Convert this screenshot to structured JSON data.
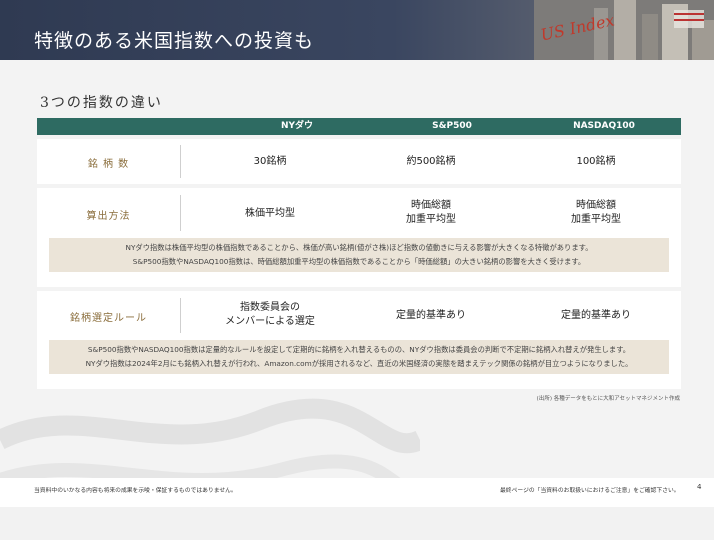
{
  "header": {
    "title": "特徴のある米国指数への投資も",
    "logo_text": "US Index"
  },
  "section": {
    "title": "3つの指数の違い"
  },
  "table": {
    "columns": [
      "NYダウ",
      "S&P500",
      "NASDAQ100"
    ],
    "rows": [
      {
        "label": "銘 柄 数",
        "cells": [
          [
            "30銘柄"
          ],
          [
            "約500銘柄"
          ],
          [
            "100銘柄"
          ]
        ]
      },
      {
        "label": "算出方法",
        "cells": [
          [
            "株価平均型"
          ],
          [
            "時価総額",
            "加重平均型"
          ],
          [
            "時価総額",
            "加重平均型"
          ]
        ]
      },
      {
        "label": "銘柄選定ルール",
        "cells": [
          [
            "指数委員会の",
            "メンバーによる選定"
          ],
          [
            "定量的基準あり"
          ],
          [
            "定量的基準あり"
          ]
        ]
      }
    ],
    "notes": [
      [
        "NYダウ指数は株価平均型の株価指数であることから、株価が高い銘柄(値がさ株)ほど指数の値動きに与える影響が大きくなる特徴があります。",
        "S&P500指数やNASDAQ100指数は、時価総額加重平均型の株価指数であることから「時価総額」の大きい銘柄の影響を大きく受けます。"
      ],
      [
        "S&P500指数やNASDAQ100指数は定量的なルールを設定して定期的に銘柄を入れ替えるものの、NYダウ指数は委員会の判断で不定期に銘柄入れ替えが発生します。",
        "NYダウ指数は2024年2月にも銘柄入れ替えが行われ、Amazon.comが採用されるなど、直近の米国経済の実態を踏まえテック関係の銘柄が目立つようになりました。"
      ]
    ]
  },
  "source": "(出所) 各種データをもとに大和アセットマネジメント作成",
  "footer": {
    "left": "当資料中のいかなる内容も将来の成果を示唆・保証するものではありません。",
    "right": "最終ページの「当資料のお取扱いにおけるご注意」をご確認下さい。",
    "page_number": "4"
  },
  "colors": {
    "header_bg": "#2f3a52",
    "table_head_bg": "#2e6b62",
    "label_text": "#8a6d3b",
    "note_bg": "#ebe4d8",
    "logo_red": "#c0392b"
  },
  "icons": [
    "city-skyline-image",
    "us-index-logo",
    "decorative-swirl"
  ]
}
